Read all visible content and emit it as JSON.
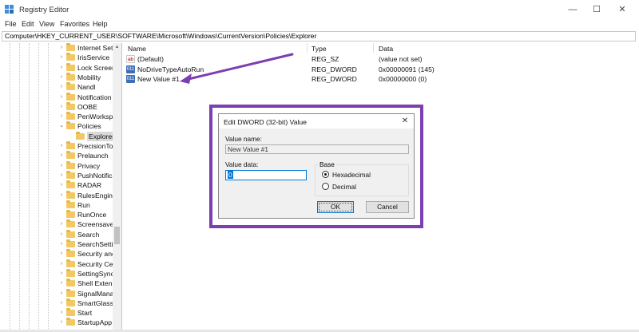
{
  "window": {
    "title": "Registry Editor",
    "controls": {
      "minimize": "—",
      "maximize": "☐",
      "close": "✕"
    }
  },
  "menu": [
    "File",
    "Edit",
    "View",
    "Favorites",
    "Help"
  ],
  "address": "Computer\\HKEY_CURRENT_USER\\SOFTWARE\\Microsoft\\Windows\\CurrentVersion\\Policies\\Explorer",
  "tree": [
    {
      "label": "Internet Set",
      "expander": "›"
    },
    {
      "label": "IrisService",
      "expander": "›"
    },
    {
      "label": "Lock Screen",
      "expander": "›"
    },
    {
      "label": "Mobility",
      "expander": "›"
    },
    {
      "label": "Nandl",
      "expander": "›"
    },
    {
      "label": "Notification",
      "expander": "›"
    },
    {
      "label": "OOBE",
      "expander": "›"
    },
    {
      "label": "PenWorkspa",
      "expander": "›"
    },
    {
      "label": "Policies",
      "expander": "⌄"
    },
    {
      "label": "Explorer",
      "expander": "",
      "child": true,
      "selected": true
    },
    {
      "label": "PrecisionTo",
      "expander": "›"
    },
    {
      "label": "Prelaunch",
      "expander": "›"
    },
    {
      "label": "Privacy",
      "expander": "›"
    },
    {
      "label": "PushNotifica",
      "expander": "›"
    },
    {
      "label": "RADAR",
      "expander": "›"
    },
    {
      "label": "RulesEngine",
      "expander": "›"
    },
    {
      "label": "Run",
      "expander": ""
    },
    {
      "label": "RunOnce",
      "expander": ""
    },
    {
      "label": "Screensaver",
      "expander": "›"
    },
    {
      "label": "Search",
      "expander": "›"
    },
    {
      "label": "SearchSetti",
      "expander": "›"
    },
    {
      "label": "Security and",
      "expander": "›"
    },
    {
      "label": "Security Cen",
      "expander": "›"
    },
    {
      "label": "SettingSync",
      "expander": "›"
    },
    {
      "label": "Shell Extens",
      "expander": "›"
    },
    {
      "label": "SignalMana",
      "expander": "›"
    },
    {
      "label": "SmartGlass",
      "expander": "›"
    },
    {
      "label": "Start",
      "expander": "›"
    },
    {
      "label": "StartupApp",
      "expander": "›"
    }
  ],
  "list": {
    "columns": {
      "name": "Name",
      "type": "Type",
      "data": "Data"
    },
    "rows": [
      {
        "name": "(Default)",
        "type": "REG_SZ",
        "data": "(value not set)",
        "icon": "string-value-icon",
        "glyph": "ab"
      },
      {
        "name": "NoDriveTypeAutoRun",
        "type": "REG_DWORD",
        "data": "0x00000091 (145)",
        "icon": "dword-value-icon",
        "glyph": "011"
      },
      {
        "name": "New Value #1",
        "type": "REG_DWORD",
        "data": "0x00000000 (0)",
        "icon": "dword-value-icon",
        "glyph": "011"
      }
    ]
  },
  "dialog": {
    "title": "Edit DWORD (32-bit) Value",
    "close": "✕",
    "value_name_label": "Value name:",
    "value_name": "New Value #1",
    "value_data_label": "Value data:",
    "value_data": "0",
    "base_label": "Base",
    "hex_label": "Hexadecimal",
    "dec_label": "Decimal",
    "ok": "OK",
    "cancel": "Cancel"
  },
  "colors": {
    "annotation": "#7b3fb0",
    "accent": "#0078d7"
  }
}
